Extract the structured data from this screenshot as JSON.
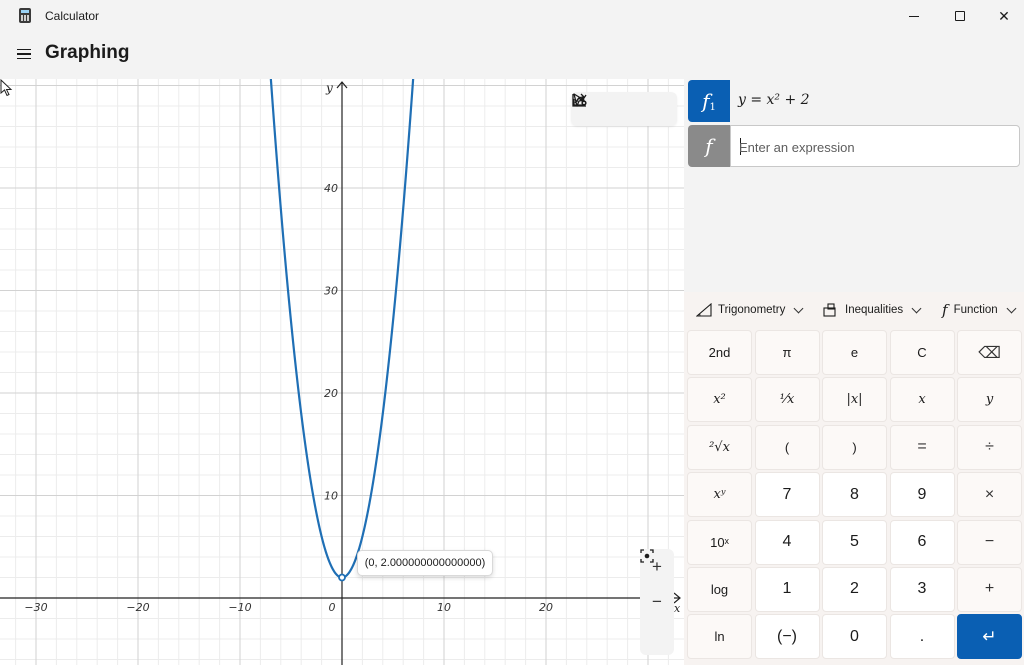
{
  "window": {
    "app_title": "Calculator",
    "minimize": "—",
    "maximize": "☐",
    "close": "✕"
  },
  "header": {
    "title": "Graphing",
    "menu_icon": "hamburger-icon"
  },
  "graph": {
    "x_axis_label": "x",
    "y_axis_label": "y",
    "x_ticks": [
      "−30",
      "−20",
      "−10",
      "0",
      "10",
      "20"
    ],
    "y_ticks": [
      "10",
      "20",
      "30",
      "40"
    ],
    "tooltip": "(0, 2.000000000000000)",
    "toolbar": [
      "select-icon",
      "share-icon",
      "graph-options-icon"
    ],
    "zoom_in": "+",
    "zoom_out": "−",
    "fit_icon": "fit-view-icon",
    "curve_color": "#1f6fb5"
  },
  "expressions": {
    "f1_badge": "f",
    "f1_sub": "1",
    "f1_text": "y = x² + 2",
    "new_badge": "f",
    "new_placeholder": "Enter an expression",
    "accent": "#0a5fb3"
  },
  "dropdowns": {
    "trig": "Trigonometry",
    "ineq": "Inequalities",
    "func": "Function"
  },
  "keypad": [
    [
      "2nd",
      "π",
      "e",
      "C",
      "⌫"
    ],
    [
      "x²",
      "¹⁄x",
      "|x|",
      "x",
      "y"
    ],
    [
      "²√x",
      "(",
      ")",
      "=",
      "÷"
    ],
    [
      "xʸ",
      "7",
      "8",
      "9",
      "×"
    ],
    [
      "10ˣ",
      "4",
      "5",
      "6",
      "−"
    ],
    [
      "log",
      "1",
      "2",
      "3",
      "+"
    ],
    [
      "ln",
      "(−)",
      "0",
      ".",
      "↵"
    ]
  ]
}
